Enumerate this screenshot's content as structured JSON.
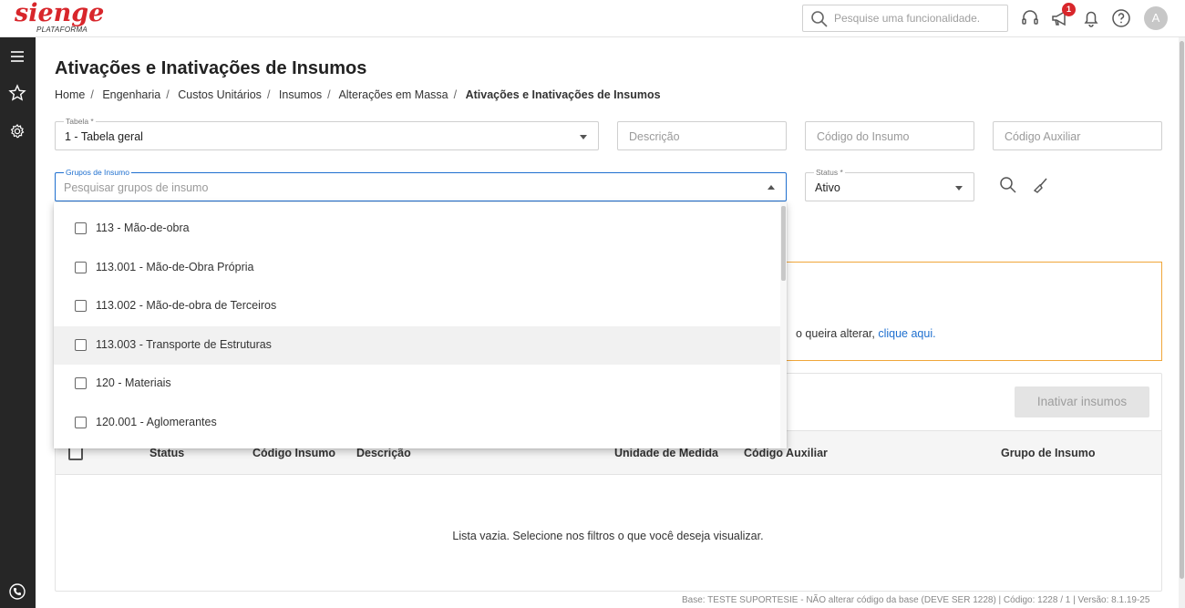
{
  "header": {
    "logo_text": "sienge",
    "logo_sub": "PLATAFORMA",
    "search_placeholder": "Pesquise uma funcionalidade.",
    "notification_count": "1",
    "avatar_initial": "A"
  },
  "page": {
    "title": "Ativações e Inativações de Insumos",
    "breadcrumb": [
      "Home",
      "Engenharia",
      "Custos Unitários",
      "Insumos",
      "Alterações em Massa",
      "Ativações e Inativações de Insumos"
    ]
  },
  "filters": {
    "tabela_label": "Tabela *",
    "tabela_value": "1 - Tabela geral",
    "descricao_placeholder": "Descrição",
    "codigo_insumo_placeholder": "Código do Insumo",
    "codigo_auxiliar_placeholder": "Código Auxiliar",
    "grupos_label": "Grupos de Insumo",
    "grupos_placeholder": "Pesquisar grupos de insumo",
    "status_label": "Status *",
    "status_value": "Ativo"
  },
  "dropdown": {
    "items": [
      {
        "label": "113 - Mão-de-obra",
        "checked": false
      },
      {
        "label": "113.001 - Mão-de-Obra Própria",
        "checked": false
      },
      {
        "label": "113.002 - Mão-de-obra de Terceiros",
        "checked": false
      },
      {
        "label": "113.003 - Transporte de Estruturas",
        "checked": false
      },
      {
        "label": "120 - Materiais",
        "checked": false
      },
      {
        "label": "120.001 - Aglomerantes",
        "checked": false
      }
    ]
  },
  "alert": {
    "text_visible": "o queira alterar,",
    "link_text": "clique aqui."
  },
  "table": {
    "action_button": "Inativar insumos",
    "columns": [
      "Status",
      "Código Insumo",
      "Descrição",
      "Unidade de Medida",
      "Código Auxiliar",
      "Grupo de Insumo"
    ],
    "empty_message": "Lista vazia. Selecione nos filtros o que você deseja visualizar."
  },
  "footer": {
    "text": "Base: TESTE SUPORTESIE - NÃO alterar código da base (DEVE SER 1228) | Código: 1228 / 1 | Versão: 8.1.19-25"
  },
  "colors": {
    "brand_red": "#d8262b",
    "sidebar_bg": "#262626",
    "focus_blue": "#1e6fcf",
    "alert_orange": "#f0a63a"
  }
}
